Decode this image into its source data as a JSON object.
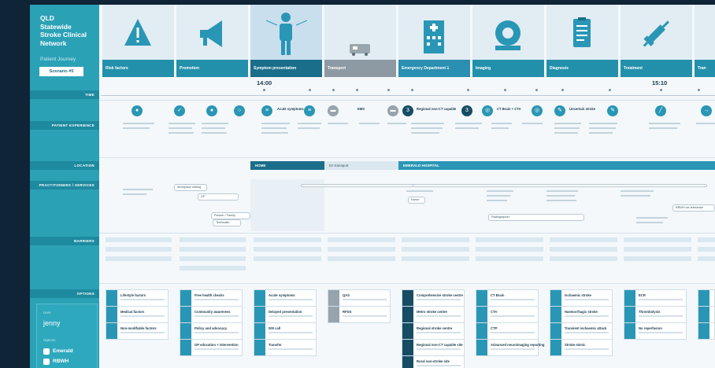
{
  "sidebar": {
    "brand_lines": [
      "QLD",
      "Statewide",
      "Stroke Clinical",
      "Network"
    ],
    "subtitle": "Patient Journey",
    "scenario": "Scenario #5",
    "row_labels": {
      "time": "TIME",
      "patient_experience": "PATIENT EXPERIENCE",
      "location": "LOCATION",
      "practitioners": "PRACTITIONERS / SERVICES",
      "barriers": "BARRIERS",
      "options": "OPTIONS"
    },
    "user": {
      "label": "User",
      "name": "jenny",
      "label2": "Options",
      "items": [
        "Emerald",
        "RBWH"
      ]
    }
  },
  "stages": [
    {
      "label": "Risk factors",
      "icon": "warning-icon"
    },
    {
      "label": "Promotion",
      "icon": "megaphone-icon"
    },
    {
      "label": "Symptom presentation",
      "icon": "person-icon"
    },
    {
      "label": "Transport",
      "icon": "ambulance-icon"
    },
    {
      "label": "Emergency Department 1",
      "icon": "hospital-icon"
    },
    {
      "label": "Imaging",
      "icon": "scanner-icon"
    },
    {
      "label": "Diagnosis",
      "icon": "clipboard-icon"
    },
    {
      "label": "Treatment",
      "icon": "syringe-icon"
    },
    {
      "label": "Tran",
      "icon": "transfer-icon"
    }
  ],
  "time": {
    "start": "14:00",
    "end": "15:10"
  },
  "patient_experience": {
    "symptoms": "Acute symptoms",
    "ems": "EMS",
    "ed_triage": "Regional non-CT capable",
    "ct": "CT Brain + CTA",
    "uncertain": "Uncertain stroke"
  },
  "location": {
    "home": "HOME",
    "transit": "En transport",
    "hospital": "EMERALD HOSPITAL"
  },
  "practitioners": {
    "gp_box": "Workplace setting",
    "gp": "GP",
    "partner": "Partner / Family",
    "cms": "Telehealth",
    "triage": "Nurse",
    "radiographer": "Radiographer",
    "rbwh": "RBWH via telestroke"
  },
  "options": {
    "col1": [
      "Lifestyle factors",
      "Medical factors",
      "Non-modifiable factors"
    ],
    "col2": [
      "Free health checks",
      "Community awareness",
      "Policy and advocacy",
      "GP education + intervention"
    ],
    "col3": [
      "Acute symptoms",
      "Delayed presentation",
      "000 call",
      "Transfer"
    ],
    "col4": [
      "QAS",
      "RFDS"
    ],
    "col5": [
      "Comprehensive stroke centre",
      "Metro stroke centre",
      "Regional stroke centre",
      "Regional non-CT capable site",
      "Rural non-stroke site"
    ],
    "col6": [
      "CT Brain",
      "CTA",
      "CTP",
      "Advanced neuroimaging reporting"
    ],
    "col7": [
      "Ischaemic stroke",
      "Haemorrhagic stroke",
      "Transient ischaemic attack",
      "Stroke mimic"
    ],
    "col8": [
      "ECR",
      "Thrombolysis",
      "No reperfusion"
    ]
  }
}
